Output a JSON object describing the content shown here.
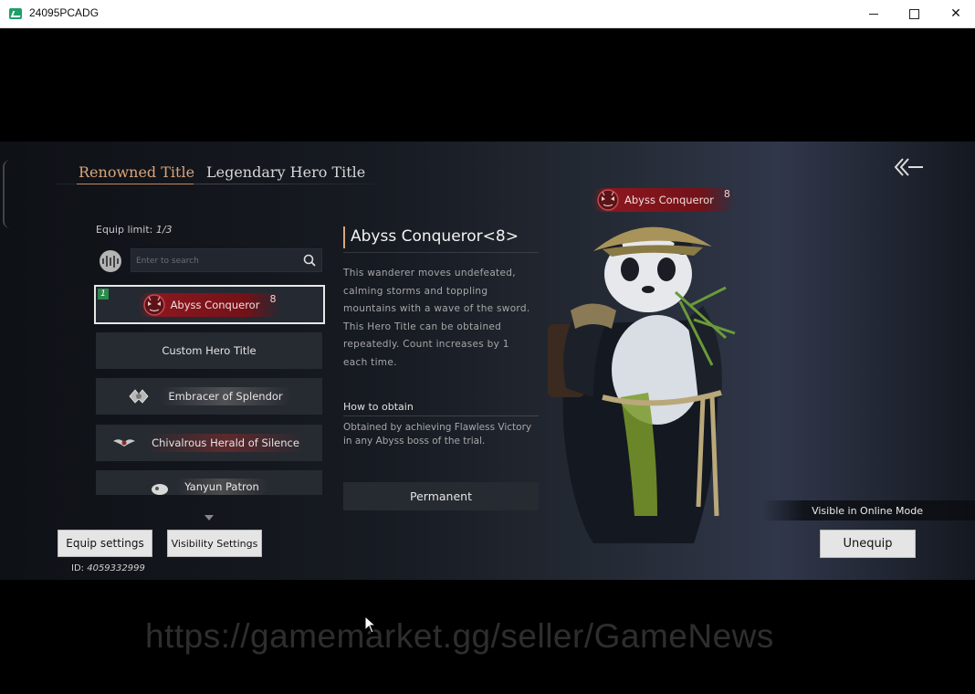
{
  "window": {
    "title": "24095PCADG",
    "minimize_icon": "minimize-icon",
    "maximize_icon": "maximize-icon",
    "close_icon": "close-icon"
  },
  "tabs": [
    {
      "label": "Renowned Title",
      "active": true
    },
    {
      "label": "Legendary Hero Title",
      "active": false
    }
  ],
  "equip_limit": {
    "label": "Equip limit:",
    "value": "1/3"
  },
  "search": {
    "placeholder": "Enter to search"
  },
  "title_list": [
    {
      "label": "Abyss Conqueror",
      "count": "8",
      "index": "1",
      "selected": true
    },
    {
      "label": "Custom Hero Title"
    },
    {
      "label": "Embracer of Splendor"
    },
    {
      "label": "Chivalrous Herald of Silence"
    },
    {
      "label": "Yanyun Patron"
    }
  ],
  "detail": {
    "title": "Abyss Conqueror<8>",
    "description": "This wanderer moves undefeated, calming storms and toppling mountains with a wave of the sword. This Hero Title can be obtained repeatedly. Count increases by 1 each time.",
    "how_to_obtain_label": "How to obtain",
    "how_to_obtain": "Obtained by achieving Flawless Victory in any Abyss boss of the trial.",
    "duration": "Permanent"
  },
  "character_badge": {
    "label": "Abyss Conqueror",
    "count": "8"
  },
  "buttons": {
    "equip_settings": "Equip settings",
    "visibility_settings": "Visibility Settings",
    "unequip": "Unequip"
  },
  "visible_online": "Visible in Online Mode",
  "player_id": {
    "label": "ID:",
    "value": "4059332999"
  },
  "watermark": "https://gamemarket.gg/seller/GameNews",
  "colors": {
    "accent": "#d9a57a",
    "badge_red": "#9a1a22",
    "selected_border": "#e8e8e8"
  }
}
